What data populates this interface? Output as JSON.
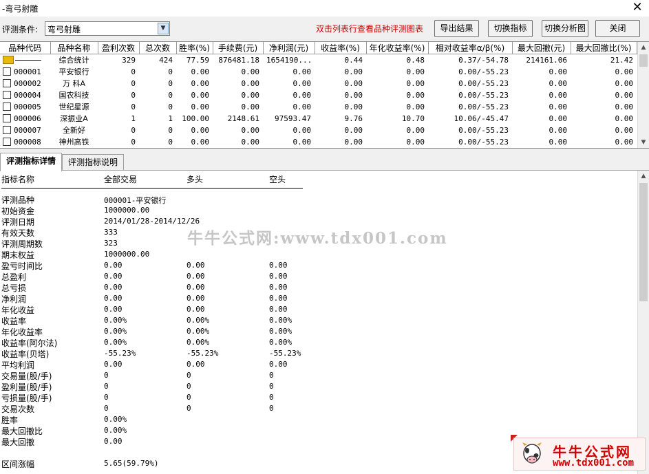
{
  "window": {
    "title": "-弯弓射雕",
    "close_glyph": "✕"
  },
  "toolbar": {
    "condition_label": "评测条件:",
    "condition_value": "弯弓射雕",
    "hint": "双击列表行查看品种评测图表",
    "buttons": {
      "export": "导出结果",
      "switch_indicator": "切换指标",
      "switch_chart": "切换分析图",
      "close": "关闭"
    }
  },
  "grid": {
    "columns": [
      "品种代码",
      "品种名称",
      "盈利次数",
      "总次数",
      "胜率(%)",
      "手续费(元)",
      "净利润(元)",
      "收益率(%)",
      "年化收益率(%)",
      "相对收益率α/β(%)",
      "最大回撤(元)",
      "最大回撤比(%)"
    ],
    "summary": [
      "",
      "综合统计",
      "329",
      "424",
      "77.59",
      "876481.18",
      "1654190...",
      "0.44",
      "0.48",
      "0.37/-54.78",
      "214161.06",
      "21.42"
    ],
    "rows": [
      [
        "000001",
        "平安银行",
        "0",
        "0",
        "0.00",
        "0.00",
        "0.00",
        "0.00",
        "0.00",
        "0.00/-55.23",
        "0.00",
        "0.00"
      ],
      [
        "000002",
        "万 科A",
        "0",
        "0",
        "0.00",
        "0.00",
        "0.00",
        "0.00",
        "0.00",
        "0.00/-55.23",
        "0.00",
        "0.00"
      ],
      [
        "000004",
        "国农科技",
        "0",
        "0",
        "0.00",
        "0.00",
        "0.00",
        "0.00",
        "0.00",
        "0.00/-55.23",
        "0.00",
        "0.00"
      ],
      [
        "000005",
        "世纪星源",
        "0",
        "0",
        "0.00",
        "0.00",
        "0.00",
        "0.00",
        "0.00",
        "0.00/-55.23",
        "0.00",
        "0.00"
      ],
      [
        "000006",
        "深振业A",
        "1",
        "1",
        "100.00",
        "2148.61",
        "97593.47",
        "9.76",
        "10.70",
        "10.06/-45.47",
        "0.00",
        "0.00"
      ],
      [
        "000007",
        "全新好",
        "0",
        "0",
        "0.00",
        "0.00",
        "0.00",
        "0.00",
        "0.00",
        "0.00/-55.23",
        "0.00",
        "0.00"
      ],
      [
        "000008",
        "神州高铁",
        "0",
        "0",
        "0.00",
        "0.00",
        "0.00",
        "0.00",
        "0.00",
        "0.00/-55.23",
        "0.00",
        "0.00"
      ]
    ]
  },
  "tabs": [
    "评测指标详情",
    "评测指标说明"
  ],
  "detail": {
    "headers": [
      "指标名称",
      "全部交易",
      "多头",
      "空头"
    ],
    "rows": [
      [
        "评测品种",
        "000001-平安银行",
        "",
        ""
      ],
      [
        "初始资金",
        "1000000.00",
        "",
        ""
      ],
      [
        "评测日期",
        "2014/01/28-2014/12/26",
        "",
        ""
      ],
      [
        "有效天数",
        "333",
        "",
        ""
      ],
      [
        "评测周期数",
        "323",
        "",
        ""
      ],
      [
        "期末权益",
        "1000000.00",
        "",
        ""
      ],
      [
        "盈亏时间比",
        "0.00",
        "0.00",
        "0.00"
      ],
      [
        "总盈利",
        "0.00",
        "0.00",
        "0.00"
      ],
      [
        "总亏损",
        "0.00",
        "0.00",
        "0.00"
      ],
      [
        "净利润",
        "0.00",
        "0.00",
        "0.00"
      ],
      [
        "年化收益",
        "0.00",
        "0.00",
        "0.00"
      ],
      [
        "收益率",
        "0.00%",
        "0.00%",
        "0.00%"
      ],
      [
        "年化收益率",
        "0.00%",
        "0.00%",
        "0.00%"
      ],
      [
        "收益率(阿尔法)",
        "0.00%",
        "0.00%",
        "0.00%"
      ],
      [
        "收益率(贝塔)",
        "-55.23%",
        "-55.23%",
        "-55.23%"
      ],
      [
        "平均利润",
        "0.00",
        "0.00",
        "0.00"
      ],
      [
        "交易量(股/手)",
        "0",
        "0",
        "0"
      ],
      [
        "盈利量(股/手)",
        "0",
        "0",
        "0"
      ],
      [
        "亏损量(股/手)",
        "0",
        "0",
        "0"
      ],
      [
        "交易次数",
        "0",
        "0",
        "0"
      ],
      [
        "胜率",
        "0.00%",
        "",
        ""
      ],
      [
        "最大回撤比",
        "0.00%",
        "",
        ""
      ],
      [
        "最大回撤",
        "0.00",
        "",
        ""
      ],
      [
        "",
        "",
        "",
        ""
      ],
      [
        "区间涨幅",
        "5.65(59.79%)",
        "",
        ""
      ]
    ]
  },
  "watermark": "牛牛公式网:www.tdx001.com",
  "logo": {
    "title": "牛牛公式网",
    "url": "www.tdx001.com"
  },
  "icons": {
    "summary_row": "summary-folder-icon",
    "stock_row": "document-icon",
    "dropdown": "chevron-down-icon",
    "scroll_up": "scroll-up-arrow-icon",
    "scroll_down": "scroll-down-arrow-icon",
    "mascot": "cow-icon"
  },
  "colors": {
    "hint": "#cc0000",
    "logo": "#d00000",
    "summary_icon": "#e8b80a"
  }
}
